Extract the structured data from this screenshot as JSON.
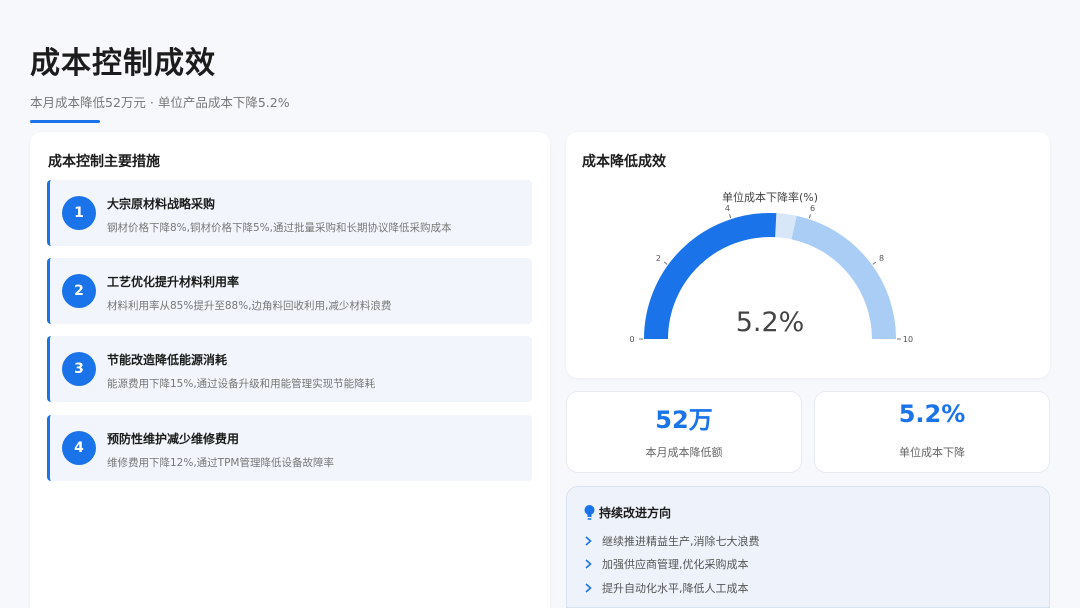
{
  "header": {
    "title": "成本控制成效",
    "subtitle": "本月成本降低52万元 · 单位产品成本下降5.2%"
  },
  "measures": {
    "title": "成本控制主要措施",
    "items": [
      {
        "num": "1",
        "title": "大宗原材料战略采购",
        "desc": "钢材价格下降8%,铜材价格下降5%,通过批量采购和长期协议降低采购成本"
      },
      {
        "num": "2",
        "title": "工艺优化提升材料利用率",
        "desc": "材料利用率从85%提升至88%,边角料回收利用,减少材料浪费"
      },
      {
        "num": "3",
        "title": "节能改造降低能源消耗",
        "desc": "能源费用下降15%,通过设备升级和用能管理实现节能降耗"
      },
      {
        "num": "4",
        "title": "预防性维护减少维修费用",
        "desc": "维修费用下降12%,通过TPM管理降低设备故障率"
      }
    ]
  },
  "gauge": {
    "card_title": "成本降低成效",
    "value_text": "5.2%"
  },
  "chart_data": {
    "type": "gauge",
    "title": "单位成本下降率(%)",
    "value": 5.2,
    "range": [
      0,
      10
    ],
    "ticks": [
      "0",
      "2",
      "4",
      "6",
      "8",
      "10"
    ],
    "colors": {
      "value": "#1a73e8",
      "rest": "#a9cdf5",
      "track": "#d8e7f8"
    }
  },
  "stats": [
    {
      "value": "52万",
      "label": "本月成本降低额"
    },
    {
      "value": "5.2%",
      "label": "单位成本下降"
    }
  ],
  "improve": {
    "title": "持续改进方向",
    "items": [
      "继续推进精益生产,消除七大浪费",
      "加强供应商管理,优化采购成本",
      "提升自动化水平,降低人工成本"
    ]
  },
  "colors": {
    "accent": "#1a73e8"
  }
}
